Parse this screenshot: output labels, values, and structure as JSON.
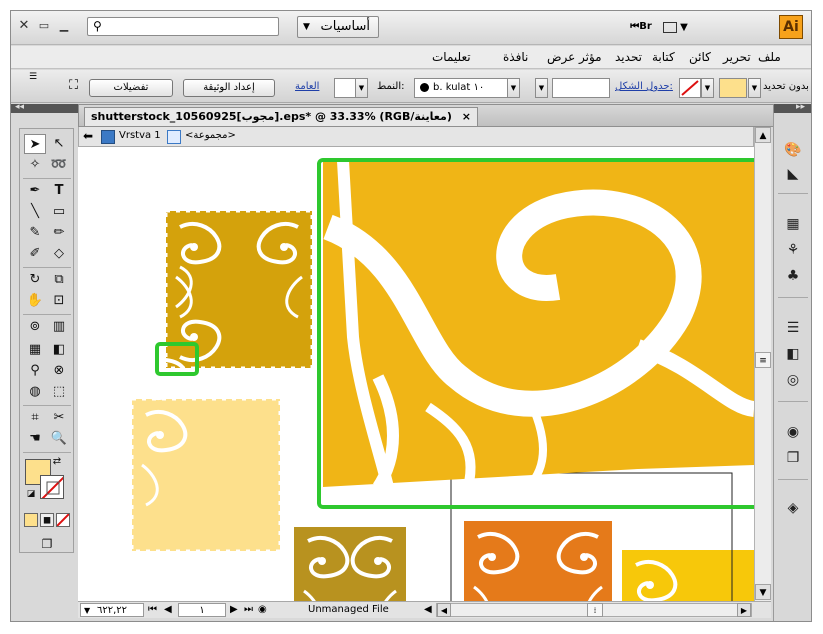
{
  "app": {
    "logo_text": "Ai",
    "workspace_label": "أساسيات",
    "bridge_label": "Br",
    "window_controls": [
      "close-icon",
      "restore-icon"
    ]
  },
  "menu": [
    "ملف",
    "تحرير",
    "كائن",
    "كتابة",
    "تحديد",
    "مؤثر",
    "عرض",
    "نافذة",
    "تعليمات"
  ],
  "control_bar": {
    "selection_label": "بدون تحديد",
    "stroke_label": "جدول الشكل:",
    "brush_value": "b. kulat ١٠",
    "style_label": "النمط:",
    "general_label": "العامة",
    "doc_setup_button": "إعداد الوثيقة",
    "preferences_button": "تفضيلات"
  },
  "document": {
    "tab_title": "shutterstock_10560925[مجوب].eps* @ 33.33% (RGB/معاينة)",
    "tab_close": "×",
    "layer_name": "Vrstva 1",
    "group_name": "<مجموعة>"
  },
  "status": {
    "zoom_value": "٦٢٢,٢٢",
    "artboard_value": "١",
    "profile_text": "Unmanaged File"
  },
  "colors": {
    "gold_dark": "#d4a20c",
    "gold_light": "#fde08c",
    "orange": "#f0b516",
    "orange_dark": "#e57a1a",
    "olive": "#b8921f",
    "yellow": "#f7c80a",
    "highlight": "#2ec82e"
  }
}
